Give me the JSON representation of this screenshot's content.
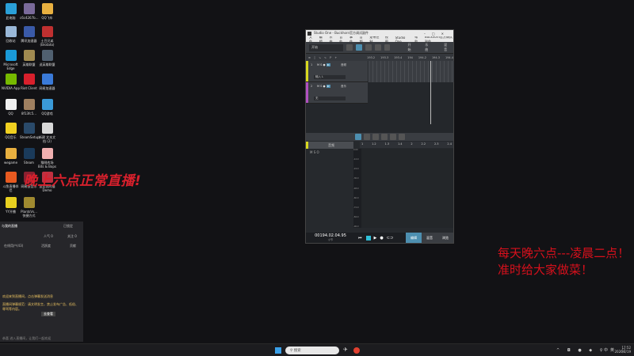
{
  "desktop": {
    "icons": [
      {
        "label": "此电脑",
        "color": "#2aa0d8"
      },
      {
        "label": "c6c4267b...",
        "color": "#7a6a9a"
      },
      {
        "label": "QQ飞车",
        "color": "#e8b040"
      },
      {
        "label": "回收站",
        "color": "#9ab8d8"
      },
      {
        "label": "腾讯加速器",
        "color": "#3a5aa8"
      },
      {
        "label": "土豆兄弟 (Brotato)",
        "color": "#c03030"
      },
      {
        "label": "Microsoft Edge",
        "color": "#1a9ad8"
      },
      {
        "label": "英雄联盟",
        "color": "#a08a50"
      },
      {
        "label": "送英雄联盟",
        "color": "#506070"
      },
      {
        "label": "NVIDIA App",
        "color": "#76b900"
      },
      {
        "label": "Riot Client",
        "color": "#d8202c"
      },
      {
        "label": "网易加速器",
        "color": "#3a7ad8"
      },
      {
        "label": "QQ",
        "color": "#f0f0f0"
      },
      {
        "label": "8f13fc5...",
        "color": "#a08060"
      },
      {
        "label": "QQ游戏",
        "color": "#3a9ad8"
      },
      {
        "label": "QQ音乐",
        "color": "#f0d020"
      },
      {
        "label": "SteamSetup",
        "color": "#2a4a6a"
      },
      {
        "label": "新建 文本文档 (2)",
        "color": "#d8d8d8"
      },
      {
        "label": "wegame",
        "color": "#e8b040"
      },
      {
        "label": "Steam",
        "color": "#1a3a5a"
      },
      {
        "label": "猫咪农场 Bits & Bops",
        "color": "#f0b0b0"
      },
      {
        "label": "斗鱼直播伴侣",
        "color": "#e85a20"
      },
      {
        "label": "网易云音乐",
        "color": "#8a2030"
      },
      {
        "label": "这是我的猫 Demo",
        "color": "#c03040"
      },
      {
        "label": "YY开播",
        "color": "#e8d020"
      },
      {
        "label": "PlantsVs... 快捷方式",
        "color": "#a08a30"
      }
    ]
  },
  "overlay_text": {
    "banner": "晚上六点正常直播!",
    "schedule": "每天晚六点---凌晨二点！ 准时给大家做菜！"
  },
  "daw": {
    "title": "Studio One - Buckhorn官方调试副件",
    "menu": [
      "文件",
      "编辑",
      "乐曲",
      "音轨",
      "事件",
      "音频",
      "走带控制",
      "视图",
      "Studio One",
      "帮助",
      "Buckhorn官方调试副件"
    ],
    "toolbar": {
      "preset": "开始",
      "start": "开始",
      "song": "乐曲",
      "mix": "混音"
    },
    "ruler": [
      "193.2",
      "193.3",
      "193.4",
      "194",
      "194.2",
      "194.3",
      "194.4"
    ],
    "tracks": [
      {
        "num": "1",
        "name": "音频",
        "input": "输入 L",
        "color": "#d8d820"
      },
      {
        "num": "2",
        "name": "音乐",
        "input": "无",
        "color": "#b050c0"
      }
    ],
    "editor": {
      "track": "音频",
      "ruler": [
        "1",
        "1.2",
        "1.3",
        "1.4",
        "2",
        "2.2",
        "2.3",
        "2.4"
      ],
      "db": [
        "0.00",
        "-12.0",
        "-24.0",
        "-36.0",
        "-48.0",
        "-60.0",
        "-72.0",
        "-84.0",
        "-96.0"
      ]
    },
    "transport": {
      "time": "00194.02.04.95",
      "unit": "小节",
      "tabs": [
        "编辑",
        "混音",
        "浏览"
      ]
    },
    "accent": "#4d8fb0"
  },
  "panel": {
    "lock": "已锁定",
    "title": "与我的直播",
    "popularity": "人气 0",
    "follow": "关注 0",
    "viewers": "在线用户(43)",
    "activity": "活跃度",
    "gift": "贡献",
    "notice1": "欢迎来到直播间，点击弹幕发送消息",
    "notice2": "直播间弹幕规范：请文明发言，禁止发布广告、低俗、辱骂等内容。",
    "btn": "去查看",
    "footer": "恭喜 进入直播间，让我们一起欢迎",
    "stats": {
      "cpu": "CPU 7%",
      "net": "网速 0kb/s",
      "fps": "FPS 60",
      "loss": "丢帧 0.00%"
    }
  },
  "taskbar": {
    "search": "搜索",
    "lang": "中",
    "time": "17:52",
    "date": "2026/2/19"
  }
}
